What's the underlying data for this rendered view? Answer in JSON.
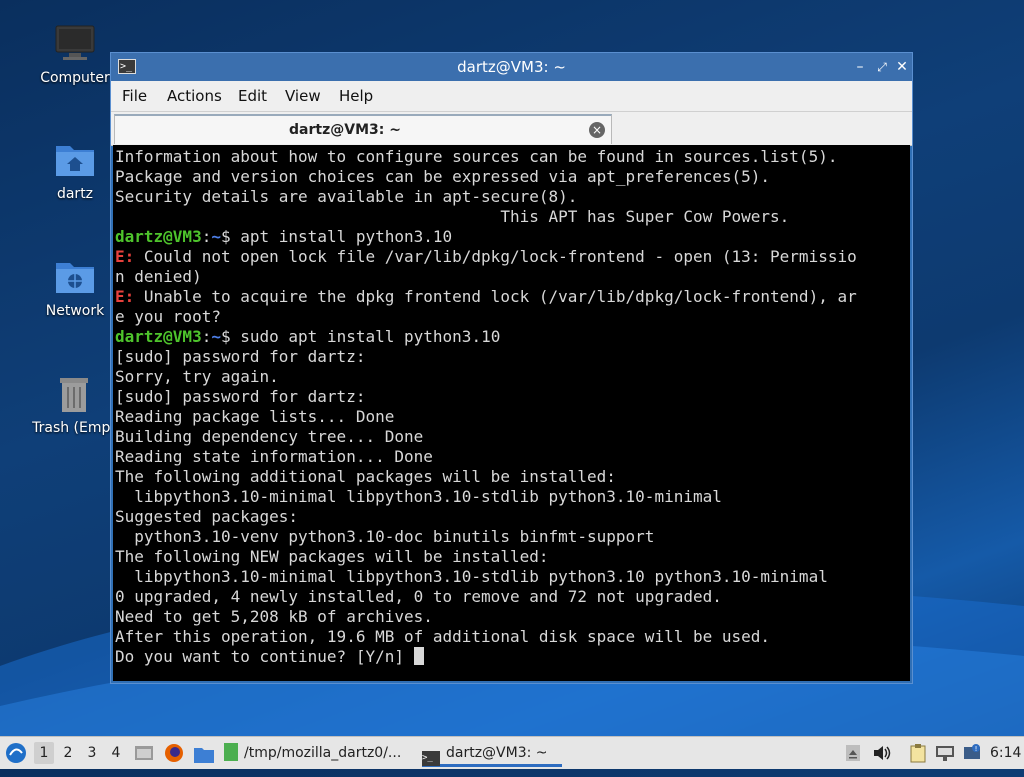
{
  "desktop": {
    "icons": [
      {
        "label": "Computer",
        "icon": "computer-icon"
      },
      {
        "label": "dartz",
        "icon": "home-folder-icon"
      },
      {
        "label": "Network",
        "icon": "network-folder-icon"
      },
      {
        "label": "Trash (Empt",
        "icon": "trash-icon"
      }
    ]
  },
  "window": {
    "title": "dartz@VM3: ~",
    "menu": [
      "File",
      "Actions",
      "Edit",
      "View",
      "Help"
    ],
    "tab_title": "dartz@VM3: ~"
  },
  "terminal": {
    "lines": [
      {
        "type": "text",
        "text": "Information about how to configure sources can be found in sources.list(5)."
      },
      {
        "type": "text",
        "text": "Package and version choices can be expressed via apt_preferences(5)."
      },
      {
        "type": "text",
        "text": "Security details are available in apt-secure(8)."
      },
      {
        "type": "text",
        "text": "                                        This APT has Super Cow Powers."
      },
      {
        "type": "prompt",
        "user": "dartz@VM3",
        "sep": ":",
        "path": "~",
        "sym": "$",
        "cmd": " apt install python3.10"
      },
      {
        "type": "error",
        "tag": "E:",
        "text": " Could not open lock file /var/lib/dpkg/lock-frontend - open (13: Permissio"
      },
      {
        "type": "text",
        "text": "n denied)"
      },
      {
        "type": "error",
        "tag": "E:",
        "text": " Unable to acquire the dpkg frontend lock (/var/lib/dpkg/lock-frontend), ar"
      },
      {
        "type": "text",
        "text": "e you root?"
      },
      {
        "type": "prompt",
        "user": "dartz@VM3",
        "sep": ":",
        "path": "~",
        "sym": "$",
        "cmd": " sudo apt install python3.10"
      },
      {
        "type": "text",
        "text": "[sudo] password for dartz:"
      },
      {
        "type": "text",
        "text": "Sorry, try again."
      },
      {
        "type": "text",
        "text": "[sudo] password for dartz:"
      },
      {
        "type": "text",
        "text": "Reading package lists... Done"
      },
      {
        "type": "text",
        "text": "Building dependency tree... Done"
      },
      {
        "type": "text",
        "text": "Reading state information... Done"
      },
      {
        "type": "text",
        "text": "The following additional packages will be installed:"
      },
      {
        "type": "text",
        "text": "  libpython3.10-minimal libpython3.10-stdlib python3.10-minimal"
      },
      {
        "type": "text",
        "text": "Suggested packages:"
      },
      {
        "type": "text",
        "text": "  python3.10-venv python3.10-doc binutils binfmt-support"
      },
      {
        "type": "text",
        "text": "The following NEW packages will be installed:"
      },
      {
        "type": "text",
        "text": "  libpython3.10-minimal libpython3.10-stdlib python3.10 python3.10-minimal"
      },
      {
        "type": "text",
        "text": "0 upgraded, 4 newly installed, 0 to remove and 72 not upgraded."
      },
      {
        "type": "text",
        "text": "Need to get 5,208 kB of archives."
      },
      {
        "type": "text",
        "text": "After this operation, 19.6 MB of additional disk space will be used."
      },
      {
        "type": "input",
        "text": "Do you want to continue? [Y/n] "
      }
    ]
  },
  "taskbar": {
    "workspaces": [
      "1",
      "2",
      "3",
      "4"
    ],
    "tasks": [
      {
        "label": "/tmp/mozilla_dartz0/...",
        "icon": "text-editor-icon"
      },
      {
        "label": "dartz@VM3: ~",
        "icon": "terminal-icon"
      }
    ],
    "clock": "6:14"
  },
  "colors": {
    "prompt_user": "#4ec42c",
    "prompt_path": "#4d7fe8",
    "error": "#e8413c",
    "titlebar": "#3b6fae"
  }
}
